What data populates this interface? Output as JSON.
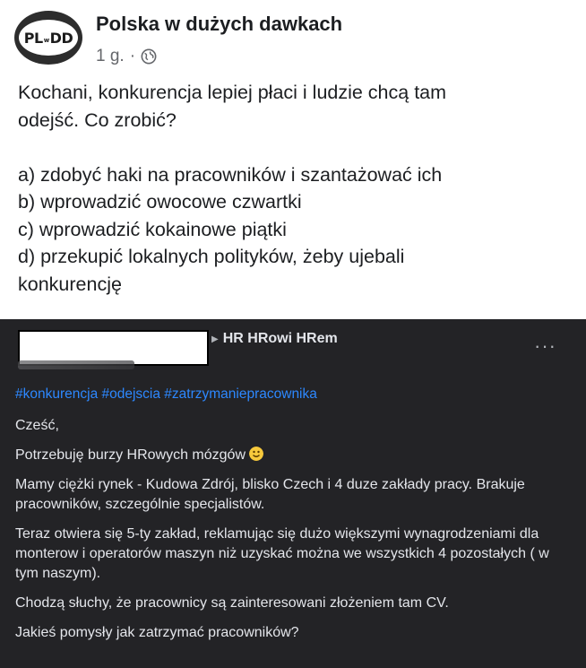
{
  "post": {
    "avatar_text": "PL",
    "avatar_text_small": "w",
    "avatar_text_end": "DD",
    "page_name": "Polska w dużych dawkach",
    "time": "1 g.",
    "separator": "·",
    "globe_icon": "globe-icon",
    "lines": [
      "Kochani, konkurencja lepiej płaci i ludzie chcą tam",
      "odejść. Co zrobić?",
      "",
      "a) zdobyć haki na pracowników i szantażować ich",
      "b) wprowadzić owocowe czwartki",
      "c) wprowadzić kokainowe piątki",
      "d) przekupić lokalnych polityków, żeby ujebali",
      "konkurencję"
    ]
  },
  "screenshot": {
    "group_name": "HR HRowi HRem",
    "more_label": "···",
    "hashtags": "#konkurencja #odejscia #zatrzymaniepracownika",
    "paragraphs": [
      "Cześć,",
      "Potrzebuję burzy HRowych mózgów",
      "Mamy ciężki rynek - Kudowa Zdrój, blisko Czech i 4 duze zakłady pracy. Brakuje pracowników, szczególnie specjalistów.",
      "Teraz otwiera się 5-ty zakład, reklamując się dużo większymi wynagrodzeniami dla monterow i operatorów maszyn niż uzyskać można we wszystkich 4 pozostałych ( w tym naszym).",
      "Chodzą słuchy, że pracownicy są zainteresowani złożeniem tam CV.",
      "Jakieś pomysły jak zatrzymać pracowników?"
    ],
    "colors": {
      "background": "#232326",
      "text": "#e4e6eb",
      "hashtag": "#2d88ff"
    }
  }
}
